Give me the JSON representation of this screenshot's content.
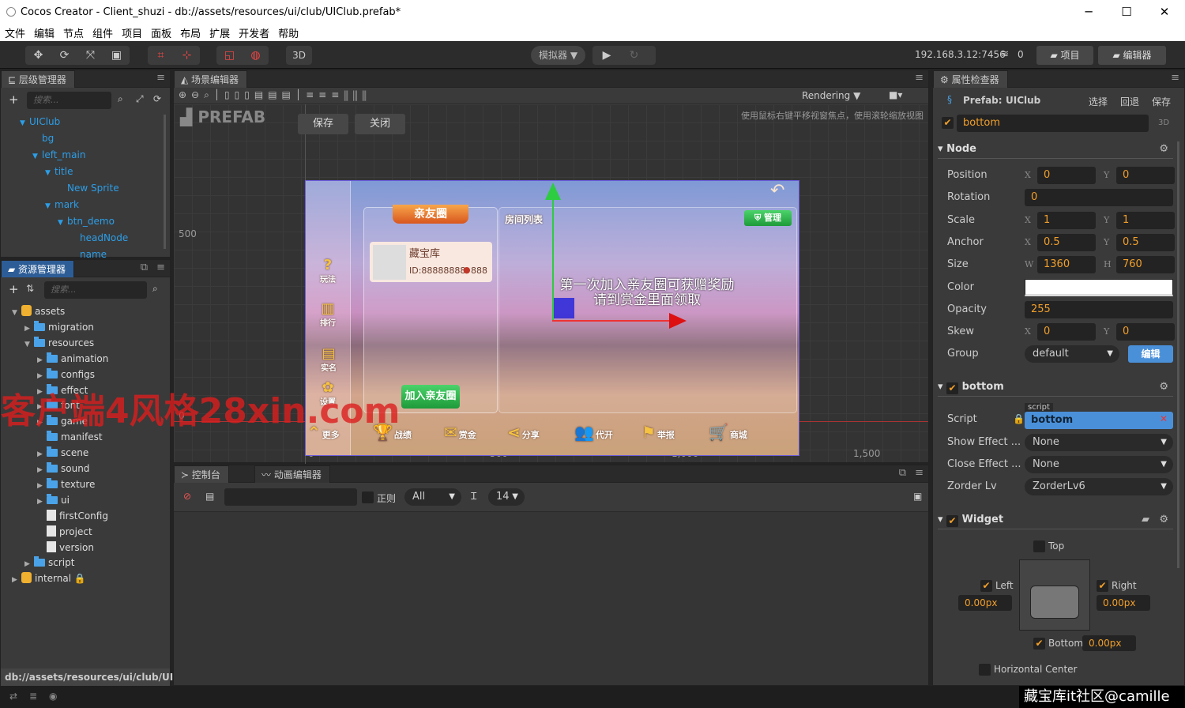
{
  "window": {
    "title": "Cocos Creator - Client_shuzi - db://assets/resources/ui/club/UIClub.prefab*",
    "minimize": "─",
    "maximize": "☐",
    "close": "✕"
  },
  "menu": [
    "文件",
    "编辑",
    "节点",
    "组件",
    "项目",
    "面板",
    "布局",
    "扩展",
    "开发者",
    "帮助"
  ],
  "toolbar": {
    "transform_tools": [
      "✥",
      "⟳",
      "⤧",
      "▣"
    ],
    "btn_3d": "3D",
    "simulator": "模拟器 ▼",
    "play": "▶",
    "refresh": "↻",
    "ip": "192.168.3.12:7456",
    "device_count": "0",
    "project_btn": "项目",
    "editor_btn": "编辑器"
  },
  "hierarchy": {
    "title": "层级管理器",
    "search_placeholder": "搜索...",
    "nodes": [
      {
        "label": "UIClub",
        "depth": 0,
        "expanded": true
      },
      {
        "label": "bg",
        "depth": 1
      },
      {
        "label": "left_main",
        "depth": 1,
        "expanded": true
      },
      {
        "label": "title",
        "depth": 2,
        "expanded": true
      },
      {
        "label": "New Sprite",
        "depth": 3
      },
      {
        "label": "mark",
        "depth": 2,
        "expanded": true
      },
      {
        "label": "btn_demo",
        "depth": 3,
        "expanded": true
      },
      {
        "label": "headNode",
        "depth": 4
      },
      {
        "label": "name",
        "depth": 4
      }
    ]
  },
  "assets": {
    "title": "资源管理器",
    "search_placeholder": "搜索...",
    "items": [
      {
        "label": "assets",
        "depth": 0,
        "type": "db",
        "arrow": "▼"
      },
      {
        "label": "migration",
        "depth": 1,
        "type": "folder",
        "arrow": "▶"
      },
      {
        "label": "resources",
        "depth": 1,
        "type": "folder",
        "arrow": "▼"
      },
      {
        "label": "animation",
        "depth": 2,
        "type": "folder",
        "arrow": "▶"
      },
      {
        "label": "configs",
        "depth": 2,
        "type": "folder",
        "arrow": "▶"
      },
      {
        "label": "effect",
        "depth": 2,
        "type": "folder",
        "arrow": "▶"
      },
      {
        "label": "font",
        "depth": 2,
        "type": "folder",
        "arrow": "▶"
      },
      {
        "label": "game",
        "depth": 2,
        "type": "folder",
        "arrow": "▶"
      },
      {
        "label": "manifest",
        "depth": 2,
        "type": "folder",
        "arrow": ""
      },
      {
        "label": "scene",
        "depth": 2,
        "type": "folder",
        "arrow": "▶"
      },
      {
        "label": "sound",
        "depth": 2,
        "type": "folder",
        "arrow": "▶"
      },
      {
        "label": "texture",
        "depth": 2,
        "type": "folder",
        "arrow": "▶"
      },
      {
        "label": "ui",
        "depth": 2,
        "type": "folder",
        "arrow": "▶"
      },
      {
        "label": "firstConfig",
        "depth": 2,
        "type": "file",
        "arrow": ""
      },
      {
        "label": "project",
        "depth": 2,
        "type": "file",
        "arrow": ""
      },
      {
        "label": "version",
        "depth": 2,
        "type": "file",
        "arrow": ""
      },
      {
        "label": "script",
        "depth": 1,
        "type": "folder",
        "arrow": "▶"
      },
      {
        "label": "internal 🔒",
        "depth": 0,
        "type": "db",
        "arrow": "▶"
      }
    ],
    "path": "db://assets/resources/ui/club/UI..."
  },
  "scene": {
    "title": "场景编辑器",
    "rendering": "Rendering ▼",
    "prefab_label": "PREFAB",
    "save": "保存",
    "close": "关闭",
    "hint": "使用鼠标右键平移视窗焦点，使用滚轮缩放视图",
    "y_ticks": [
      "500",
      "0"
    ],
    "x_ticks": [
      "0",
      "500",
      "1,000",
      "1,500"
    ]
  },
  "game": {
    "club_title": "亲友圈",
    "room_list": "房间列表",
    "manage": "管理",
    "card_name": "藏宝库",
    "card_id": "ID:88888888",
    "card_count": "888",
    "join": "加入亲友圈",
    "notice_line1": "第一次加入亲友圈可获赠奖励",
    "notice_line2": "请到赏金里面领取",
    "side": [
      "玩法",
      "排行",
      "实名",
      "设置"
    ],
    "bottom": [
      "更多",
      "战绩",
      "赏金",
      "分享",
      "代开",
      "举报",
      "商城"
    ]
  },
  "console": {
    "tab_console": "控制台",
    "tab_anim": "动画编辑器",
    "regex": "正则",
    "filter": "All",
    "font_size": "14"
  },
  "inspector": {
    "title": "属性检查器",
    "prefab_label": "Prefab:",
    "prefab_name": "UIClub",
    "select": "选择",
    "revert": "回退",
    "save": "保存",
    "node_name": "bottom",
    "btn_3d": "3D",
    "node_section": "Node",
    "props": {
      "position": {
        "label": "Position",
        "x": "0",
        "y": "0"
      },
      "rotation": {
        "label": "Rotation",
        "v": "0"
      },
      "scale": {
        "label": "Scale",
        "x": "1",
        "y": "1"
      },
      "anchor": {
        "label": "Anchor",
        "x": "0.5",
        "y": "0.5"
      },
      "size": {
        "label": "Size",
        "w": "1360",
        "h": "760"
      },
      "color": {
        "label": "Color",
        "value": "#ffffff"
      },
      "opacity": {
        "label": "Opacity",
        "v": "255"
      },
      "skew": {
        "label": "Skew",
        "x": "0",
        "y": "0"
      },
      "group": {
        "label": "Group",
        "v": "default",
        "edit": "编辑"
      }
    },
    "component": {
      "name": "bottom",
      "script_label": "Script",
      "script_tag": "script",
      "script_value": "bottom",
      "show_effect_label": "Show Effect ...",
      "show_effect": "None",
      "close_effect_label": "Close Effect ...",
      "close_effect": "None",
      "zorder_label": "Zorder Lv",
      "zorder": "ZorderLv6"
    },
    "widget": {
      "name": "Widget",
      "top": "Top",
      "left": "Left",
      "right": "Right",
      "bottom": "Bottom",
      "left_val": "0.00px",
      "right_val": "0.00px",
      "bottom_val": "0.00px",
      "hcenter": "Horizontal Center",
      "top_checked": false,
      "left_checked": true,
      "right_checked": true,
      "bottom_checked": true
    }
  },
  "watermark": {
    "overlay": "客户端4风格28xin.com",
    "corner": "藏宝库it社区@camille"
  },
  "colors": {
    "accent": "#f29f2a",
    "node_blue": "#2c9ee8",
    "selection": "#4a90d9"
  }
}
